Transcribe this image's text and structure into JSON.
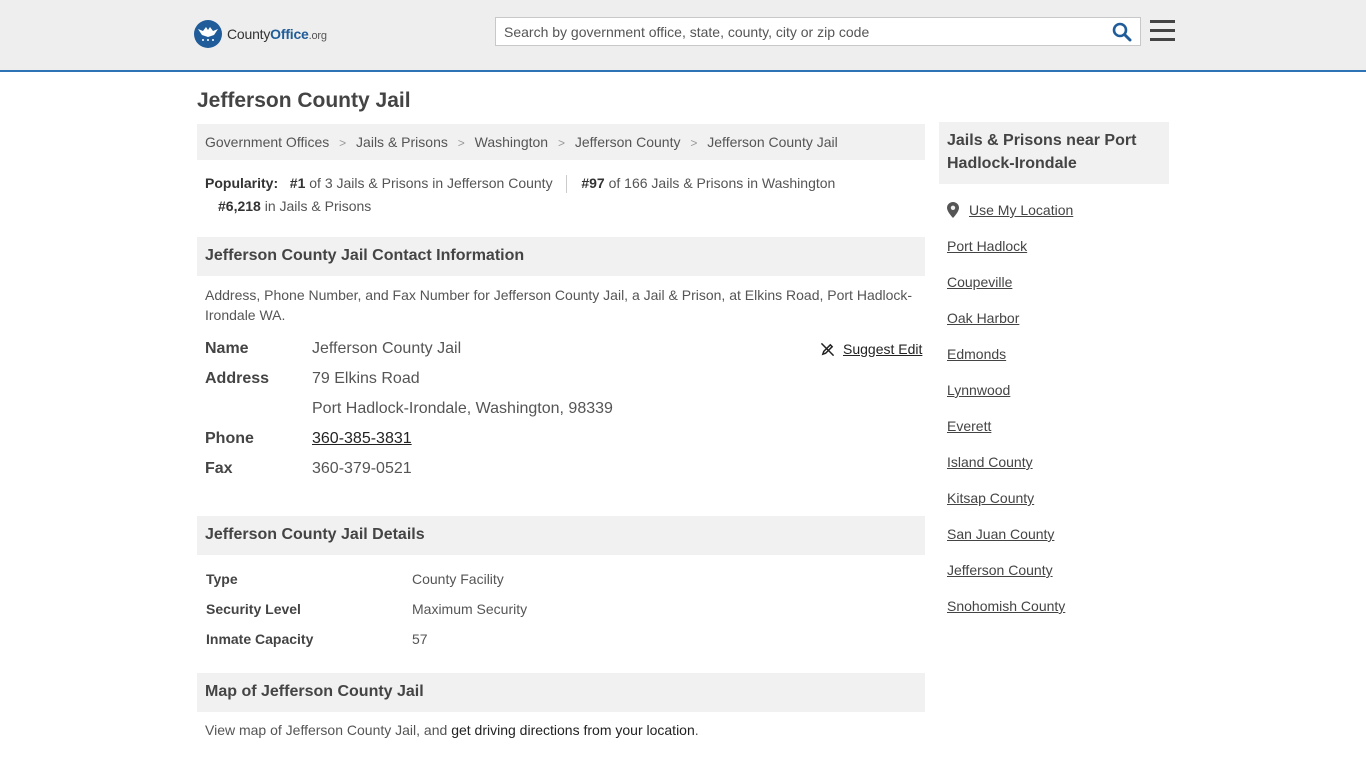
{
  "header": {
    "logo": {
      "brand_a": "County",
      "brand_b": "Office",
      "brand_c": ".org"
    },
    "search": {
      "placeholder": "Search by government office, state, county, city or zip code"
    }
  },
  "page_title": "Jefferson County Jail",
  "breadcrumb": [
    "Government Offices",
    "Jails & Prisons",
    "Washington",
    "Jefferson County",
    "Jefferson County Jail"
  ],
  "popularity": {
    "label": "Popularity:",
    "rank1": "#1",
    "rank1_text": "of 3 Jails & Prisons in Jefferson County",
    "rank2": "#97",
    "rank2_text": "of 166 Jails & Prisons in Washington",
    "rank3": "#6,218",
    "rank3_text": "in Jails & Prisons"
  },
  "contact": {
    "heading": "Jefferson County Jail Contact Information",
    "description": "Address, Phone Number, and Fax Number for Jefferson County Jail, a Jail & Prison, at Elkins Road, Port Hadlock-Irondale WA.",
    "suggest_edit": "Suggest Edit",
    "name_label": "Name",
    "name_value": "Jefferson County Jail",
    "address_label": "Address",
    "address_line1": "79 Elkins Road",
    "address_line2": "Port Hadlock-Irondale, Washington, 98339",
    "phone_label": "Phone",
    "phone_value": "360-385-3831",
    "fax_label": "Fax",
    "fax_value": "360-379-0521"
  },
  "details": {
    "heading": "Jefferson County Jail Details",
    "rows": [
      {
        "label": "Type",
        "value": "County Facility"
      },
      {
        "label": "Security Level",
        "value": "Maximum Security"
      },
      {
        "label": "Inmate Capacity",
        "value": "57"
      }
    ]
  },
  "map": {
    "heading": "Map of Jefferson County Jail",
    "text_before": "View map of Jefferson County Jail, and ",
    "link": "get driving directions from your location",
    "text_after": "."
  },
  "sidebar": {
    "heading": "Jails & Prisons near Port Hadlock-Irondale",
    "use_location": "Use My Location",
    "links": [
      "Port Hadlock",
      "Coupeville",
      "Oak Harbor",
      "Edmonds",
      "Lynnwood",
      "Everett",
      "Island County",
      "Kitsap County",
      "San Juan County",
      "Jefferson County",
      "Snohomish County"
    ]
  },
  "colors": {
    "accent": "#2e74b5",
    "logo_blue": "#1f5c99",
    "search_icon": "#1f5c99"
  }
}
